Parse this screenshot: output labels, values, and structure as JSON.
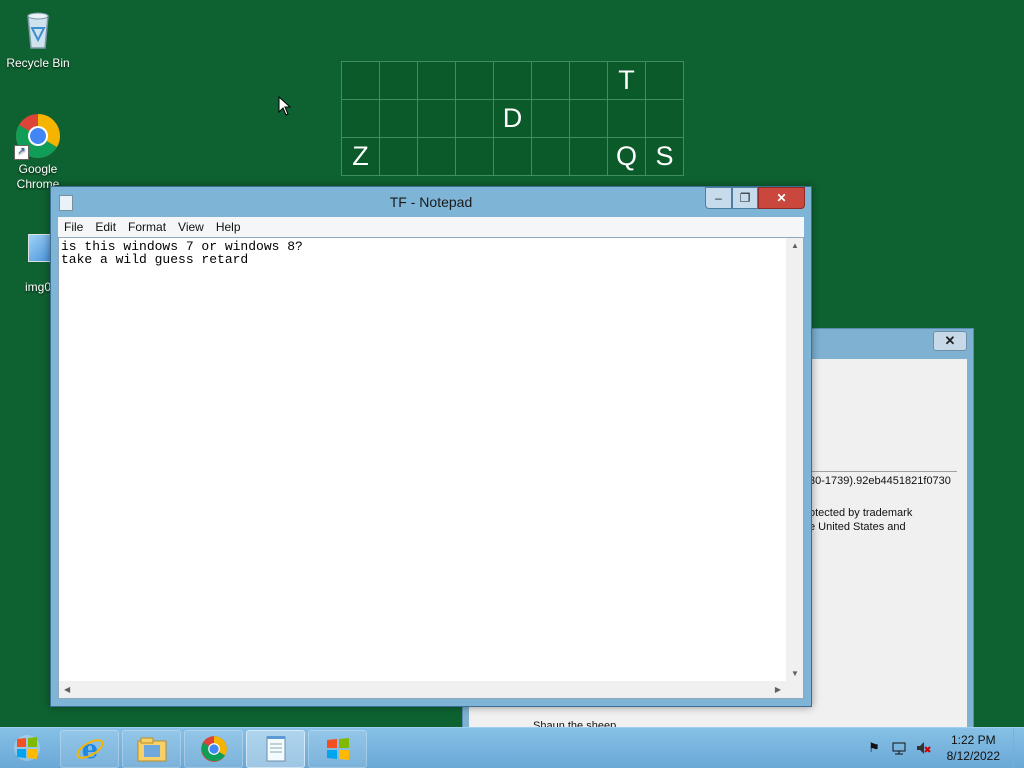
{
  "desktop": {
    "icons": [
      {
        "label": "Recycle Bin",
        "icon": "recycle-bin-icon"
      },
      {
        "label": "Google Chrome",
        "icon": "chrome-icon"
      },
      {
        "label": "img0",
        "icon": "image-file-icon"
      }
    ],
    "wallpaper_grid": {
      "rows": [
        [
          "",
          "",
          "",
          "",
          "",
          "",
          "",
          "T",
          ""
        ],
        [
          "",
          "",
          "",
          "",
          "D",
          "",
          "",
          "",
          ""
        ],
        [
          "Z",
          "",
          "",
          "",
          "",
          "",
          "",
          "Q",
          "S"
        ]
      ]
    }
  },
  "background_window": {
    "lines": [
      "30-1739).92eb4451821f0730",
      "otected by trademark",
      "e United States and",
      "Shaun the sheep"
    ]
  },
  "notepad": {
    "title": "TF - Notepad",
    "menu": [
      "File",
      "Edit",
      "Format",
      "View",
      "Help"
    ],
    "text_lines": [
      "is this windows 7 or windows 8?",
      "take a wild guess retard"
    ]
  },
  "taskbar": {
    "time": "1:22 PM",
    "date": "8/12/2022",
    "buttons": [
      {
        "icon": "start-icon"
      },
      {
        "icon": "internet-explorer-icon"
      },
      {
        "icon": "file-explorer-icon"
      },
      {
        "icon": "chrome-icon"
      },
      {
        "icon": "notepad-icon"
      },
      {
        "icon": "windows-icon"
      }
    ],
    "tray": [
      "flag-icon",
      "network-icon",
      "volume-muted-icon"
    ]
  },
  "colors": {
    "desktop": "#0e6231",
    "window_frame": "#7eb4d6",
    "close_button": "#c9473c"
  }
}
